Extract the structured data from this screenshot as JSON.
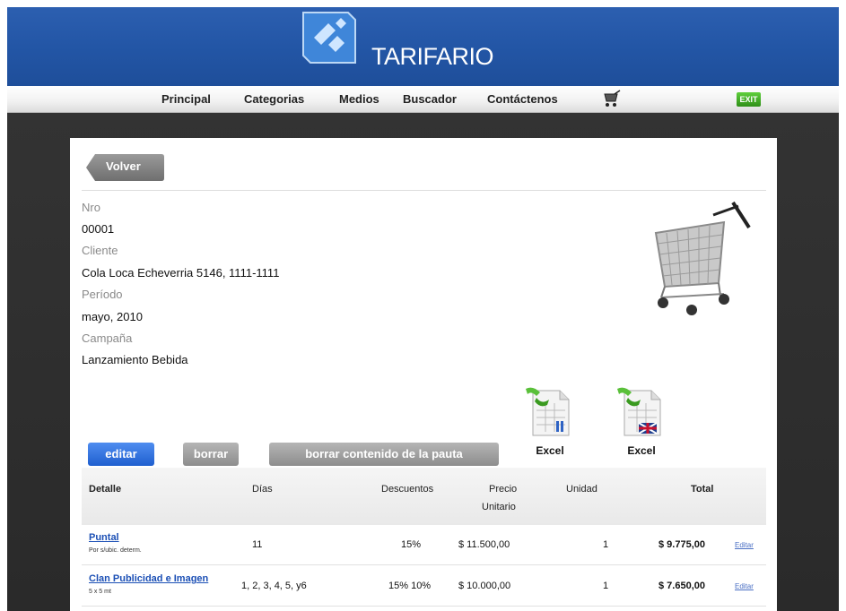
{
  "header": {
    "brand": "TARIFARIO"
  },
  "nav": {
    "items": [
      "Principal",
      "Categorias",
      "Medios",
      "Buscador",
      "Contáctenos"
    ],
    "exit_label": "EXIT"
  },
  "toolbar": {
    "back_label": "Volver"
  },
  "fields": [
    {
      "label": "Nro",
      "value": "00001"
    },
    {
      "label": "Cliente",
      "value": "Cola Loca Echeverria 5146, 1111-1111"
    },
    {
      "label": "Período",
      "value": "mayo, 2010"
    },
    {
      "label": "Campaña",
      "value": "Lanzamiento Bebida"
    }
  ],
  "actions": {
    "edit_label": "editar",
    "delete_label": "borrar",
    "clear_label": "borrar contenido de la pauta"
  },
  "exports": [
    {
      "label": "Excel"
    },
    {
      "label": "Excel"
    }
  ],
  "table": {
    "headers": [
      "Detalle",
      "Días",
      "Descuentos",
      "Precio",
      "Unitario",
      "Unidad",
      "Total"
    ],
    "rows": [
      {
        "detail": "Puntal",
        "sub": "Por s/ubic. determ.",
        "days": "11",
        "discounts": "15%",
        "price": "$ 11.500,00",
        "units": "1",
        "total": "$ 9.775,00",
        "edit": "Editar"
      },
      {
        "detail": "Clan Publicidad e Imagen",
        "sub": "5 x 5 mt",
        "days": "1, 2, 3, 4, 5, y6",
        "discounts": "15% 10%",
        "price": "$ 10.000,00",
        "units": "1",
        "total": "$ 7.650,00",
        "edit": "Editar"
      }
    ]
  },
  "colors": {
    "header_blue": "#2356a6",
    "button_blue": "#1f5fcf",
    "link_blue": "#1b4fb5"
  }
}
